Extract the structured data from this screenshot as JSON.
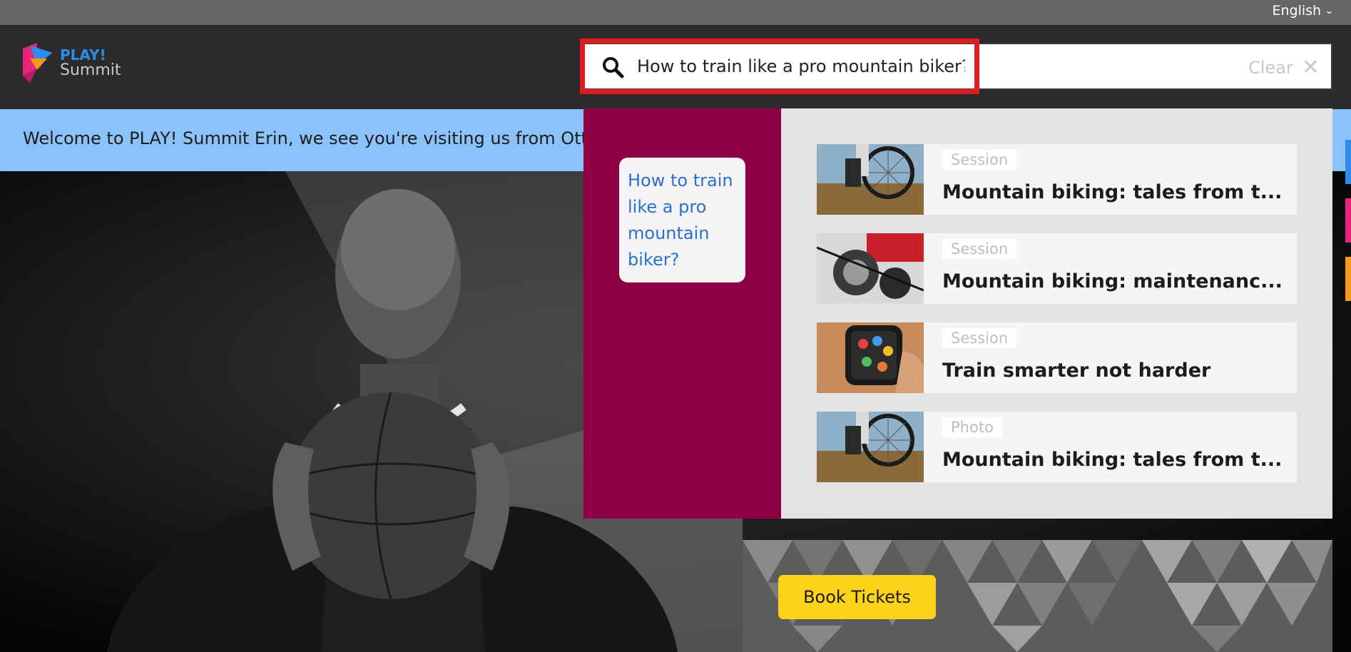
{
  "topbar": {
    "language": "English"
  },
  "header": {
    "logo": {
      "line1": "PLAY!",
      "line2": "Summit"
    },
    "search": {
      "value": "How to train like a pro mountain biker?",
      "clear_label": "Clear"
    }
  },
  "welcome": {
    "text": "Welcome to PLAY! Summit Erin, we see you're visiting us from Ottawa"
  },
  "dropdown": {
    "suggestion": "How to train like a pro mountain biker?",
    "results": [
      {
        "type": "Session",
        "title": "Mountain biking: tales from t...",
        "thumb": "bike-wheel"
      },
      {
        "type": "Session",
        "title": "Mountain biking: maintenanc...",
        "thumb": "bike-gears"
      },
      {
        "type": "Session",
        "title": "Train smarter not harder",
        "thumb": "smartwatch"
      },
      {
        "type": "Photo",
        "title": "Mountain biking: tales from t...",
        "thumb": "bike-wheel"
      }
    ]
  },
  "promo": {
    "book_label": "Book Tickets"
  },
  "colors": {
    "accent_red": "#e21b23",
    "suggest_bg": "#8d0043",
    "welcome_bg": "#8cc2fa",
    "cta_yellow": "#fcd21a",
    "link_blue": "#2a6fd0"
  }
}
